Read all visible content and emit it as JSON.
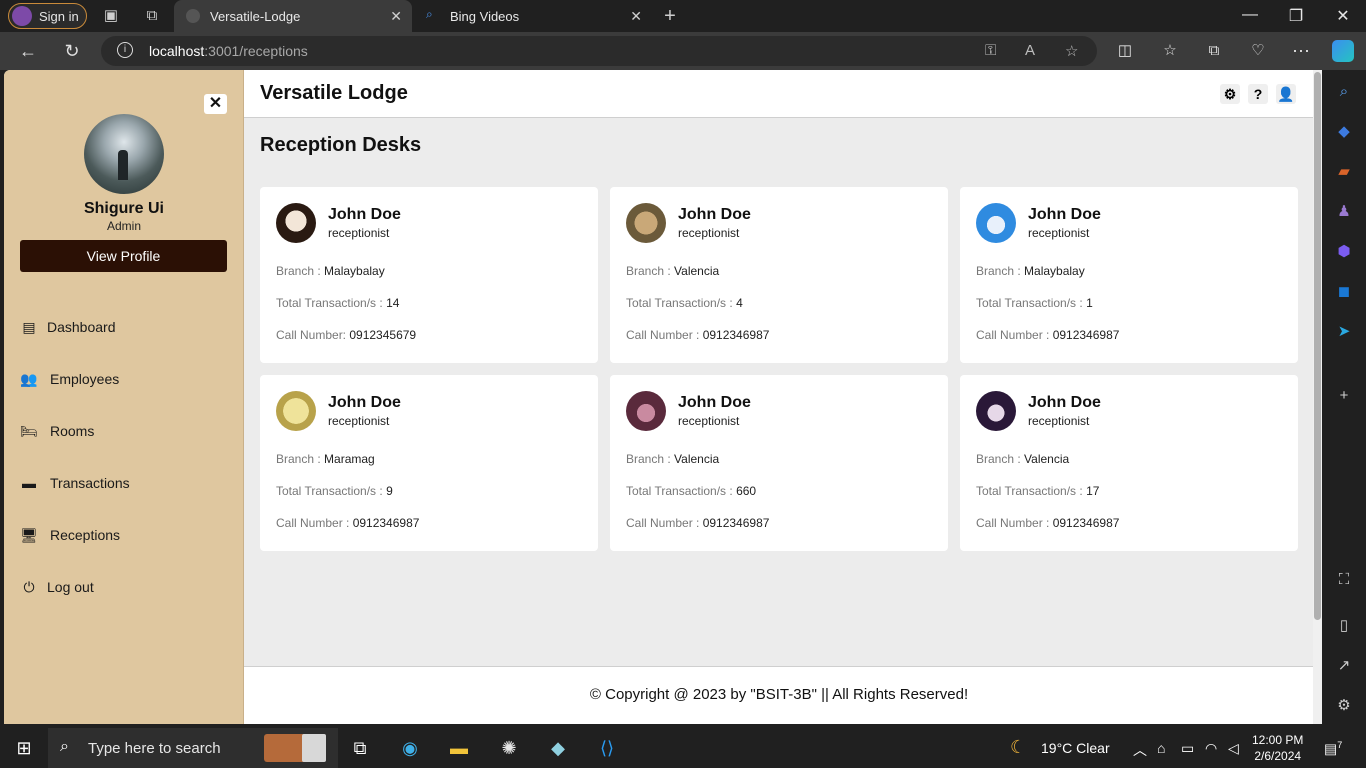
{
  "browser": {
    "signin_label": "Sign in",
    "tabs": [
      {
        "title": "Versatile-Lodge",
        "active": true
      },
      {
        "title": "Bing Videos",
        "active": false
      }
    ],
    "url_host": "localhost",
    "url_rest": ":3001/receptions"
  },
  "sidebar": {
    "user_name": "Shigure Ui",
    "user_role": "Admin",
    "view_profile": "View Profile",
    "menu": [
      {
        "label": "Dashboard",
        "icon": "chart-icon"
      },
      {
        "label": "Employees",
        "icon": "users-icon"
      },
      {
        "label": "Rooms",
        "icon": "bed-icon"
      },
      {
        "label": "Transactions",
        "icon": "card-icon"
      },
      {
        "label": "Receptions",
        "icon": "monitor-icon"
      },
      {
        "label": "Log out",
        "icon": "power-icon"
      }
    ]
  },
  "header": {
    "brand": "Versatile Lodge"
  },
  "page": {
    "title": "Reception Desks",
    "labels": {
      "branch": "Branch : ",
      "transactions": "Total Transaction/s : ",
      "call": "Call Number : ",
      "call_first": "Call Number: "
    },
    "cards": [
      {
        "name": "John Doe",
        "role": "receptionist",
        "branch": "Malaybalay",
        "transactions": "14",
        "call": "0912345679",
        "avatar_color": "#e8d8c8"
      },
      {
        "name": "John Doe",
        "role": "receptionist",
        "branch": "Valencia",
        "transactions": "4",
        "call": "0912346987",
        "avatar_color": "#b89a6c"
      },
      {
        "name": "John Doe",
        "role": "receptionist",
        "branch": "Malaybalay",
        "transactions": "1",
        "call": "0912346987",
        "avatar_color": "#2f8be0"
      },
      {
        "name": "John Doe",
        "role": "receptionist",
        "branch": "Maramag",
        "transactions": "9",
        "call": "0912346987",
        "avatar_color": "#e0cf7a"
      },
      {
        "name": "John Doe",
        "role": "receptionist",
        "branch": "Valencia",
        "transactions": "660",
        "call": "0912346987",
        "avatar_color": "#7a3f58"
      },
      {
        "name": "John Doe",
        "role": "receptionist",
        "branch": "Valencia",
        "transactions": "17",
        "call": "0912346987",
        "avatar_color": "#3a2748"
      }
    ]
  },
  "footer": {
    "copyright": "© Copyright @ 2023 by \"BSIT-3B\" || All Rights Reserved!"
  },
  "taskbar": {
    "search_placeholder": "Type here to search",
    "weather": "19°C  Clear",
    "time": "12:00 PM",
    "date": "2/6/2024",
    "notifications": "7"
  }
}
